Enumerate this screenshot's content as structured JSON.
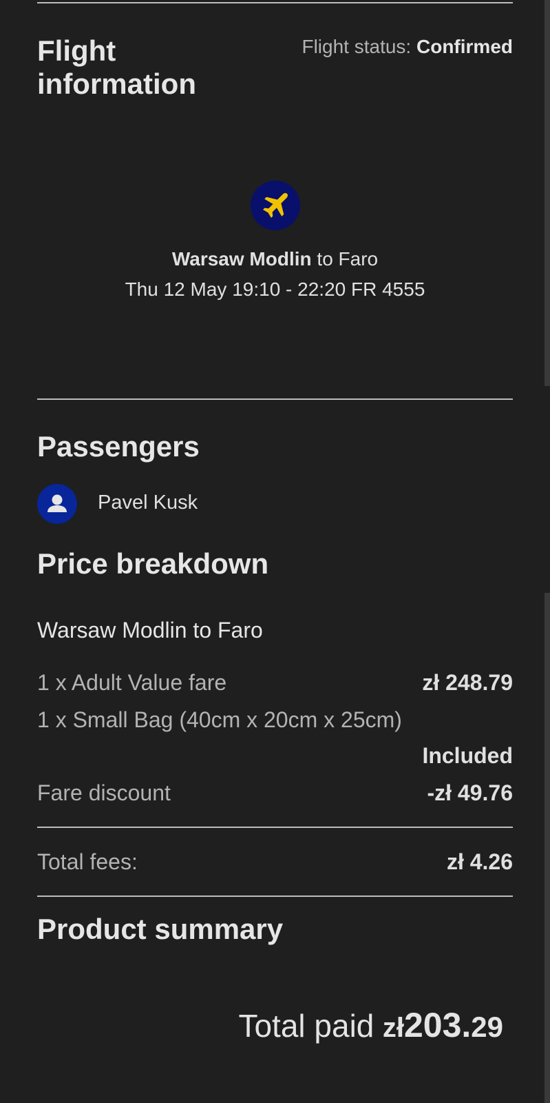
{
  "flight": {
    "title": "Flight information",
    "status_label": "Flight status:",
    "status_value": "Confirmed",
    "route_from": "Warsaw Modlin",
    "route_to_text": "to Faro",
    "schedule": "Thu 12 May 19:10 - 22:20 FR 4555",
    "icon": "airplane-icon",
    "icon_bg": "#08106b",
    "icon_color": "#f2c200"
  },
  "passengers": {
    "title": "Passengers",
    "list": [
      {
        "name": "Pavel Kusk",
        "icon": "person-icon"
      }
    ]
  },
  "price": {
    "title": "Price breakdown",
    "route": "Warsaw Modlin to Faro",
    "items": [
      {
        "label": "1 x Adult Value fare",
        "value": "zł 248.79"
      },
      {
        "label": "1 x Small Bag (40cm x 20cm x 25cm)",
        "value": "Included"
      },
      {
        "label": "Fare discount",
        "value": "-zł 49.76"
      }
    ],
    "fees_label": "Total fees:",
    "fees_value": "zł 4.26"
  },
  "product": {
    "title": "Product summary",
    "total_label": "Total paid",
    "total_currency": "zł",
    "total_main": "203.",
    "total_cents": "29"
  }
}
